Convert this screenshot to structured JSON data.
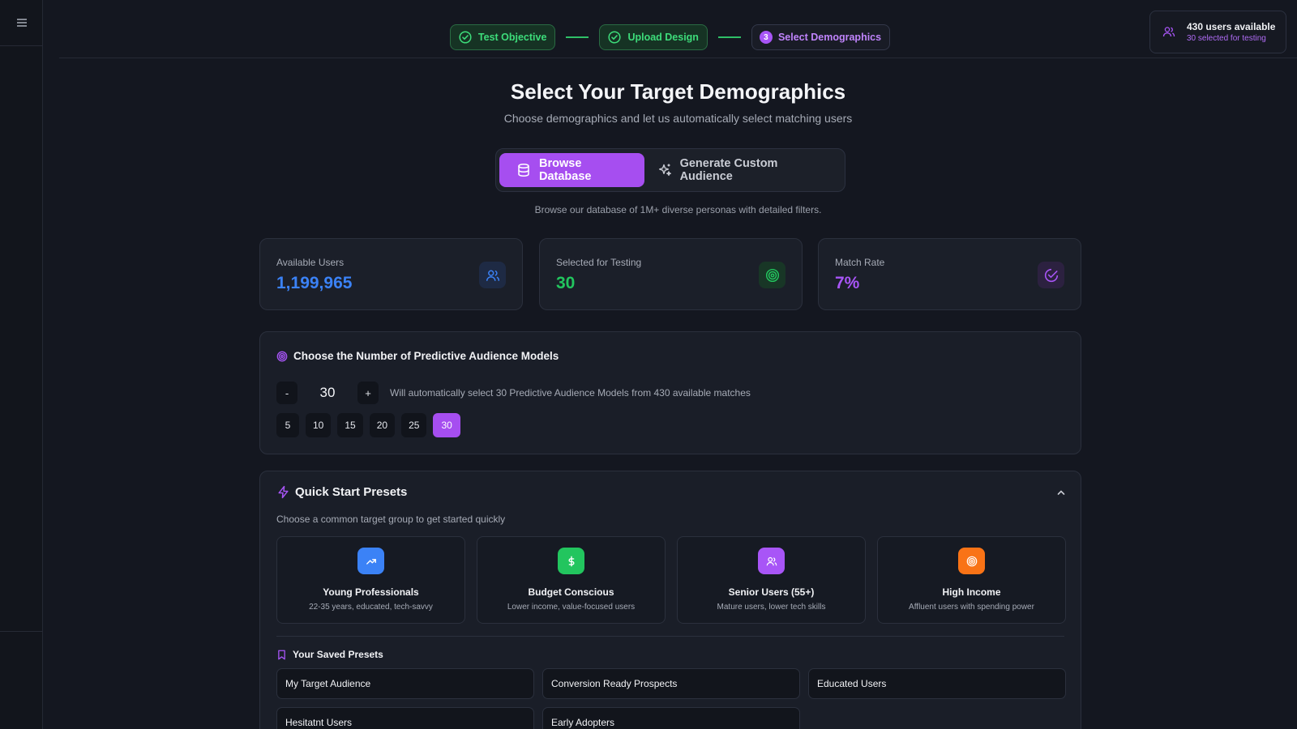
{
  "stepper": {
    "steps": [
      {
        "label": "Test Objective",
        "state": "done"
      },
      {
        "label": "Upload Design",
        "state": "done"
      },
      {
        "label": "Select Demographics",
        "state": "active",
        "number": "3"
      }
    ]
  },
  "users_pill": {
    "title": "430 users available",
    "sub": "30 selected for testing"
  },
  "page": {
    "title": "Select Your Target Demographics",
    "subtitle": "Choose demographics and let us automatically select matching users"
  },
  "mode_toggle": {
    "browse_label": "Browse Database",
    "generate_label": "Generate Custom Audience",
    "note": "Browse our database of 1M+ diverse personas with detailed filters."
  },
  "stats": [
    {
      "label": "Available Users",
      "value": "1,199,965",
      "color": "#3b82f6",
      "icon": "users-icon"
    },
    {
      "label": "Selected for Testing",
      "value": "30",
      "color": "#22c55e",
      "icon": "target-icon"
    },
    {
      "label": "Match Rate",
      "value": "7%",
      "color": "#a855f7",
      "icon": "check-circle-icon"
    }
  ],
  "models": {
    "heading": "Choose the Number of Predictive Audience Models",
    "minus": "-",
    "plus": "+",
    "count": "30",
    "note": "Will automatically select 30 Predictive Audience Models from 430 available matches",
    "quick_counts": [
      "5",
      "10",
      "15",
      "20",
      "25",
      "30"
    ],
    "selected_count": "30"
  },
  "presets": {
    "heading": "Quick Start Presets",
    "sub": "Choose a common target group to get started quickly",
    "cards": [
      {
        "title": "Young Professionals",
        "desc": "22-35 years, educated, tech-savvy",
        "color": "#3b82f6",
        "icon": "trending-up-icon"
      },
      {
        "title": "Budget Conscious",
        "desc": "Lower income, value-focused users",
        "color": "#22c55e",
        "icon": "dollar-icon"
      },
      {
        "title": "Senior Users (55+)",
        "desc": "Mature users, lower tech skills",
        "color": "#a855f7",
        "icon": "users-icon"
      },
      {
        "title": "High Income",
        "desc": "Affluent users with spending power",
        "color": "#f97316",
        "icon": "target-icon"
      }
    ],
    "saved_heading": "Your Saved Presets",
    "saved": [
      "My Target Audience",
      "Conversion Ready Prospects",
      "Educated Users",
      "Hesitatnt Users",
      "Early Adopters"
    ]
  }
}
